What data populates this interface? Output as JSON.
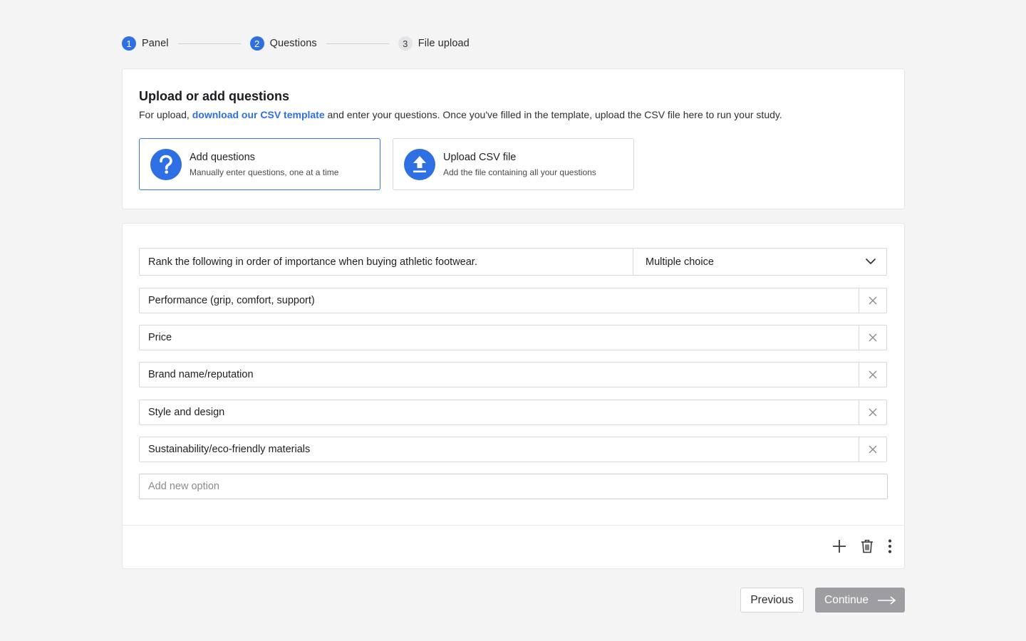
{
  "stepper": {
    "steps": [
      {
        "number": "1",
        "label": "Panel",
        "state": "complete"
      },
      {
        "number": "2",
        "label": "Questions",
        "state": "active"
      },
      {
        "number": "3",
        "label": "File upload",
        "state": "inactive"
      }
    ]
  },
  "upload_card": {
    "title": "Upload or add questions",
    "subtitle_before": "For upload, ",
    "subtitle_link": "download our CSV template",
    "subtitle_after": " and enter your questions. Once you've filled in the template, upload the CSV file here to run your study.",
    "options": [
      {
        "title": "Add questions",
        "description": "Manually enter questions, one at a time",
        "icon": "question-mark-icon",
        "selected": true
      },
      {
        "title": "Upload CSV file",
        "description": "Add the file containing all your questions",
        "icon": "upload-icon",
        "selected": false
      }
    ]
  },
  "question": {
    "text": "Rank the following in order of importance when buying athletic footwear.",
    "type": "Multiple choice",
    "options": [
      "Performance (grip, comfort, support)",
      "Price",
      "Brand name/reputation",
      "Style and design",
      "Sustainability/eco-friendly materials"
    ],
    "add_option_placeholder": "Add new option"
  },
  "toolbar": {
    "icons": [
      "plus-icon",
      "trash-icon",
      "more-vertical-icon"
    ]
  },
  "footer": {
    "previous_label": "Previous",
    "continue_label": "Continue"
  },
  "colors": {
    "accent": "#2f6fe4",
    "background": "#f4f4f5",
    "continue_disabled": "#9d9da2"
  }
}
